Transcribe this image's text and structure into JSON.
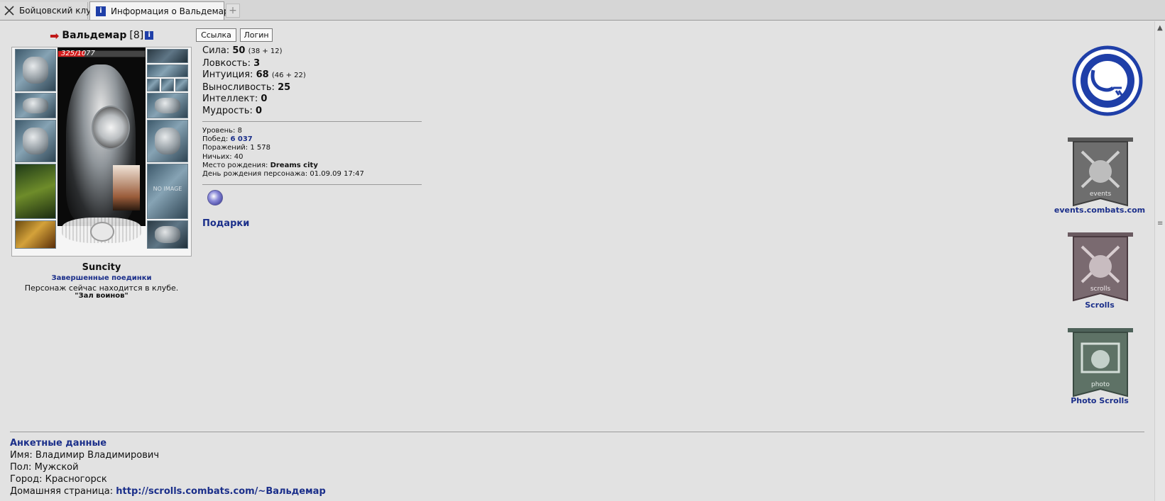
{
  "tabs": [
    {
      "label": "Бойцовский клуб",
      "icon": "crossed-swords-icon",
      "active": false
    },
    {
      "label": "Информация о Вальдемар",
      "icon": "info-icon",
      "active": true
    }
  ],
  "character": {
    "name": "Вальдемар",
    "level": "[8]",
    "hp": "325/1077",
    "hp_fraction": 0.3,
    "no_image": "NO IMAGE",
    "city": "Suncity",
    "fights_link": "Завершенные поединки",
    "location_text": "Персонаж сейчас находится в клубе.",
    "room": "\"Зал воинов\""
  },
  "buttons": {
    "link": "Ссылка",
    "login": "Логин"
  },
  "stats": [
    {
      "label": "Сила:",
      "value": "50",
      "extra": "(38 + 12)"
    },
    {
      "label": "Ловкость:",
      "value": "3",
      "extra": ""
    },
    {
      "label": "Интуиция:",
      "value": "68",
      "extra": "(46 + 22)"
    },
    {
      "label": "Выносливость:",
      "value": "25",
      "extra": ""
    },
    {
      "label": "Интеллект:",
      "value": "0",
      "extra": ""
    },
    {
      "label": "Мудрость:",
      "value": "0",
      "extra": ""
    }
  ],
  "info": {
    "level_label": "Уровень:",
    "level_value": "8",
    "wins_label": "Побед:",
    "wins_value": "6 037",
    "losses_label": "Поражений:",
    "losses_value": "1 578",
    "draws_label": "Ничьих:",
    "draws_value": "40",
    "birthplace_label": "Место рождения:",
    "birthplace_value": "Dreams city",
    "birthday_label": "День рождения персонажа:",
    "birthday_value": "01.09.09 17:47"
  },
  "gifts_label": "Подарки",
  "side_links": [
    {
      "label": "events.combats.com",
      "badge": "events",
      "color": "#6e6e6e"
    },
    {
      "label": "Scrolls",
      "badge": "scrolls",
      "color": "#7a6a70"
    },
    {
      "label": "Photo Scrolls",
      "badge": "photo",
      "color": "#5e7266"
    }
  ],
  "profile": {
    "title": "Анкетные данные",
    "name_label": "Имя:",
    "name_value": "Владимир Владимирович",
    "gender_label": "Пол:",
    "gender_value": "Мужской",
    "city_label": "Город:",
    "city_value": "Красногорск",
    "homepage_label": "Домашняя страница:",
    "homepage_value": "http://scrolls.combats.com/~Вальдемар"
  },
  "colors": {
    "link": "#1b2f8a",
    "hp": "#d21c1c",
    "background": "#e2e2e2",
    "logo_blue": "#1f3fa8"
  }
}
